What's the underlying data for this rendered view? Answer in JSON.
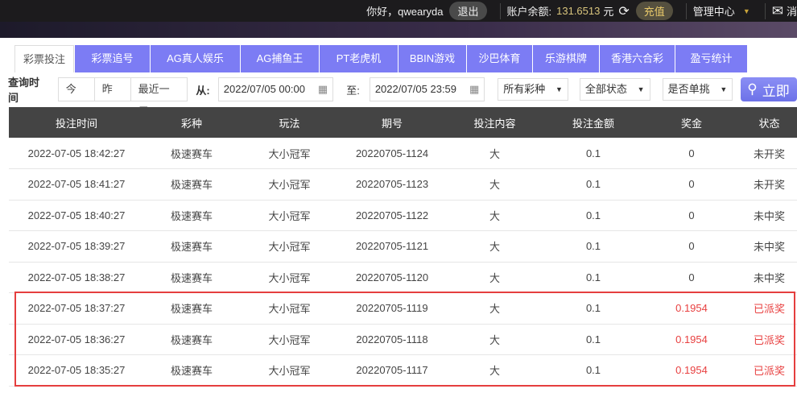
{
  "topbar": {
    "greeting": "你好，qwearyda",
    "logout": "退出",
    "balance_label": "账户余额:",
    "balance": "131.6513",
    "currency": "元",
    "recharge": "充值",
    "admin": "管理中心",
    "messages": "消"
  },
  "tabs": [
    "彩票投注",
    "彩票追号",
    "AG真人娱乐",
    "AG捕鱼王",
    "PT老虎机",
    "BBIN游戏",
    "沙巴体育",
    "乐游棋牌",
    "香港六合彩",
    "盈亏统计"
  ],
  "filters": {
    "label": "查询时间",
    "today": "今天",
    "yesterday": "昨天",
    "week": "最近一周",
    "from_label": "从:",
    "from": "2022/07/05 00:00",
    "to_label": "至:",
    "to": "2022/07/05 23:59",
    "lottery": "所有彩种",
    "status": "全部状态",
    "single": "是否单挑",
    "search": "立即"
  },
  "table": {
    "headers": [
      "投注时间",
      "彩种",
      "玩法",
      "期号",
      "投注内容",
      "投注金额",
      "奖金",
      "状态"
    ],
    "rows": [
      [
        "2022-07-05 18:42:27",
        "极速赛车",
        "大小冠军",
        "20220705-1124",
        "大",
        "0.1",
        "0",
        "未开奖"
      ],
      [
        "2022-07-05 18:41:27",
        "极速赛车",
        "大小冠军",
        "20220705-1123",
        "大",
        "0.1",
        "0",
        "未开奖"
      ],
      [
        "2022-07-05 18:40:27",
        "极速赛车",
        "大小冠军",
        "20220705-1122",
        "大",
        "0.1",
        "0",
        "未中奖"
      ],
      [
        "2022-07-05 18:39:27",
        "极速赛车",
        "大小冠军",
        "20220705-1121",
        "大",
        "0.1",
        "0",
        "未中奖"
      ],
      [
        "2022-07-05 18:38:27",
        "极速赛车",
        "大小冠军",
        "20220705-1120",
        "大",
        "0.1",
        "0",
        "未中奖"
      ],
      [
        "2022-07-05 18:37:27",
        "极速赛车",
        "大小冠军",
        "20220705-1119",
        "大",
        "0.1",
        "0.1954",
        "已派奖"
      ],
      [
        "2022-07-05 18:36:27",
        "极速赛车",
        "大小冠军",
        "20220705-1118",
        "大",
        "0.1",
        "0.1954",
        "已派奖"
      ],
      [
        "2022-07-05 18:35:27",
        "极速赛车",
        "大小冠军",
        "20220705-1117",
        "大",
        "0.1",
        "0.1954",
        "已派奖"
      ]
    ]
  },
  "colors": {
    "tab": "#7c7cf4",
    "win": "#e84040",
    "header": "#444444",
    "highlight": "#e53e3e"
  }
}
